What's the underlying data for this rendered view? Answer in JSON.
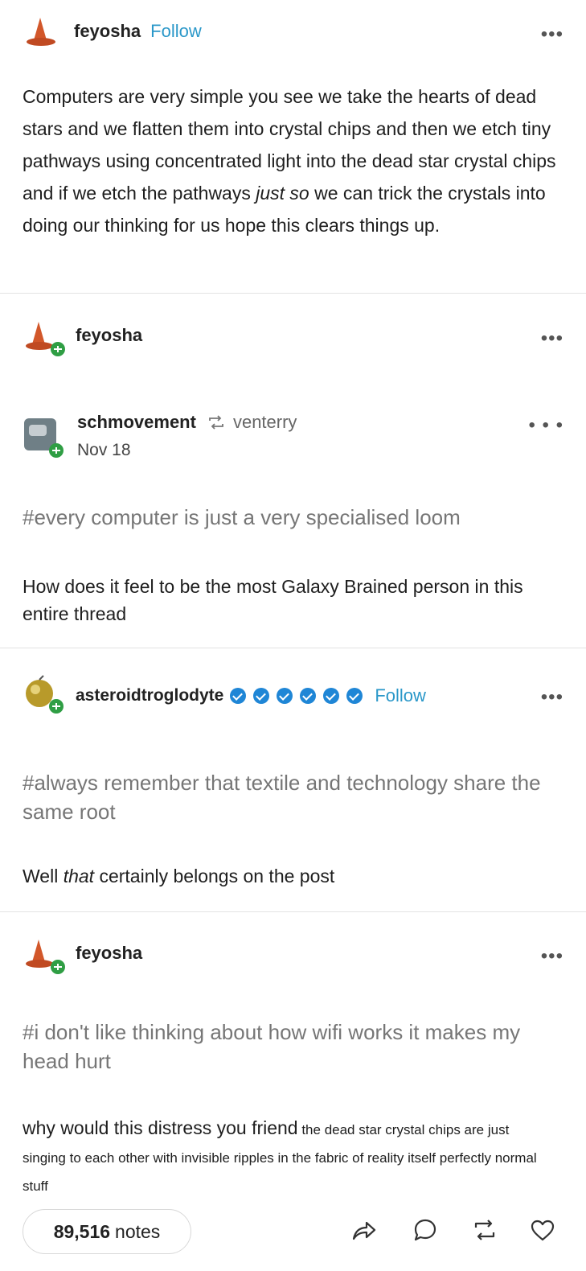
{
  "post": {
    "author": "feyosha",
    "follow_label": "Follow",
    "more_label": "•••",
    "paragraph_before_italic": "Computers are very simple you see we take the hearts of dead stars and we flatten them into crystal chips and then we etch tiny pathways using concentrated light into the dead star crystal chips and if we etch the pathways ",
    "paragraph_italic": "just so",
    "paragraph_after_italic": " we can trick the crystals into doing our thinking for us hope this clears things up."
  },
  "reblog1": {
    "author": "feyosha",
    "more_label": "•••"
  },
  "quoted": {
    "author": "schmovement",
    "reblogged_from": "venterry",
    "date": "Nov 18",
    "more_label": "• • •",
    "tag": "#every computer is just a very specialised loom",
    "text": "How does it feel to be the most Galaxy Brained person in this entire thread"
  },
  "reblog2": {
    "author": "asteroidtroglodyte",
    "badge_count": 6,
    "follow_label": "Follow",
    "more_label": "•••",
    "tag": "#always remember that textile and technology share the same root",
    "text_before_italic": "Well ",
    "text_italic": "that",
    "text_after_italic": " certainly belongs on the post"
  },
  "reblog3": {
    "author": "feyosha",
    "more_label": "•••",
    "tag": "#i don't like thinking about how wifi works it makes my head hurt",
    "text_large": "why would this distress you friend",
    "text_small": " the dead star crystal chips are just singing to each other with invisible ripples in the fabric of reality itself perfectly normal stuff"
  },
  "footer": {
    "notes_count": "89,516",
    "notes_label": "notes",
    "actions": [
      "share-icon",
      "reply-icon",
      "reblog-icon",
      "like-icon"
    ]
  },
  "colors": {
    "link_blue": "#2b98c9",
    "hat_orange": "#d2572a",
    "reblog_green": "#2f9e44",
    "badge_blue": "#1f86d6"
  }
}
